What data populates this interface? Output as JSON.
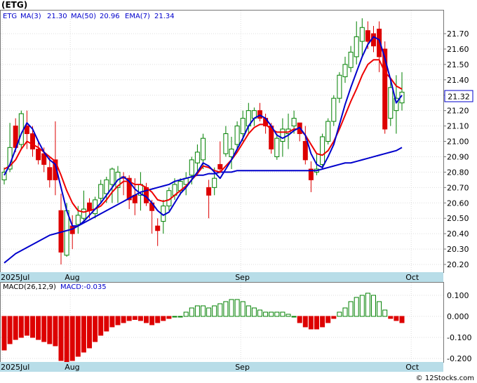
{
  "title": "(ETG)",
  "legend": {
    "ticker": "ETG",
    "ma3": "MA(3)",
    "ma3_value": "21.30",
    "ma50": "MA(50)",
    "ma50_value": "20.96",
    "ema7": "EMA(7)",
    "ema7_value": "21.34"
  },
  "macd_legend": {
    "label": "MACD(26,12,9)",
    "value": "MACD:-0.035"
  },
  "current_price_label": "21.32",
  "watermark": "© 12Stocks.com",
  "colors": {
    "up_candle_border": "#008000",
    "down_candle": "#dd0000",
    "ma_blue": "#0000cc",
    "ema_red": "#ee0000",
    "axis_band": "#b8dde8",
    "legend_text": "#0000cc"
  },
  "chart_data": [
    {
      "type": "candlestick",
      "x_labels": [
        {
          "label": "2025Jul",
          "index": 0
        },
        {
          "label": "Aug",
          "index": 12
        },
        {
          "label": "Sep",
          "index": 42
        },
        {
          "label": "Oct",
          "index": 72
        }
      ],
      "y_ticks": [
        "20.20",
        "20.30",
        "20.40",
        "20.50",
        "20.60",
        "20.70",
        "20.80",
        "20.90",
        "21.00",
        "21.10",
        "21.20",
        "21.30",
        "21.40",
        "21.50",
        "21.60",
        "21.70"
      ],
      "ylim": [
        20.14,
        21.84
      ],
      "grid": true,
      "candles": [
        [
          20.75,
          20.83,
          20.72,
          20.8
        ],
        [
          20.82,
          21.12,
          20.8,
          20.96
        ],
        [
          21.1,
          21.15,
          20.93,
          20.96
        ],
        [
          20.98,
          21.2,
          20.95,
          21.18
        ],
        [
          21.1,
          21.2,
          20.95,
          21.05
        ],
        [
          21.05,
          21.1,
          20.9,
          20.95
        ],
        [
          20.95,
          21.0,
          20.85,
          20.88
        ],
        [
          20.92,
          20.96,
          20.8,
          20.85
        ],
        [
          20.83,
          20.9,
          20.7,
          20.75
        ],
        [
          20.88,
          21.13,
          20.65,
          20.75
        ],
        [
          20.55,
          20.66,
          20.2,
          20.28
        ],
        [
          20.26,
          20.6,
          20.25,
          20.55
        ],
        [
          20.45,
          20.52,
          20.3,
          20.4
        ],
        [
          20.46,
          20.58,
          20.4,
          20.52
        ],
        [
          20.5,
          20.68,
          20.48,
          20.56
        ],
        [
          20.6,
          20.63,
          20.5,
          20.55
        ],
        [
          20.53,
          20.64,
          20.5,
          20.62
        ],
        [
          20.63,
          20.75,
          20.6,
          20.72
        ],
        [
          20.66,
          20.77,
          20.6,
          20.75
        ],
        [
          20.72,
          20.83,
          20.6,
          20.82
        ],
        [
          20.7,
          20.84,
          20.6,
          20.8
        ],
        [
          20.77,
          20.8,
          20.65,
          20.76
        ],
        [
          20.76,
          20.78,
          20.56,
          20.62
        ],
        [
          20.65,
          20.76,
          20.52,
          20.6
        ],
        [
          20.65,
          20.8,
          20.55,
          20.72
        ],
        [
          20.7,
          20.73,
          20.58,
          20.6
        ],
        [
          20.6,
          20.62,
          20.4,
          20.55
        ],
        [
          20.45,
          20.5,
          20.32,
          20.42
        ],
        [
          20.48,
          20.62,
          20.4,
          20.58
        ],
        [
          20.58,
          20.7,
          20.55,
          20.68
        ],
        [
          20.65,
          20.76,
          20.62,
          20.72
        ],
        [
          20.68,
          20.76,
          20.65,
          20.74
        ],
        [
          20.72,
          20.8,
          20.65,
          20.76
        ],
        [
          20.78,
          20.9,
          20.72,
          20.88
        ],
        [
          20.86,
          20.98,
          20.8,
          20.93
        ],
        [
          20.88,
          21.05,
          20.82,
          21.02
        ],
        [
          20.7,
          20.75,
          20.5,
          20.65
        ],
        [
          20.7,
          20.83,
          20.65,
          20.76
        ],
        [
          20.85,
          21.0,
          20.8,
          20.82
        ],
        [
          20.92,
          21.1,
          20.9,
          21.05
        ],
        [
          20.9,
          21.03,
          20.82,
          20.95
        ],
        [
          20.98,
          21.13,
          20.95,
          21.1
        ],
        [
          21.05,
          21.2,
          21.0,
          21.15
        ],
        [
          21.1,
          21.25,
          21.05,
          21.2
        ],
        [
          21.15,
          21.22,
          21.1,
          21.2
        ],
        [
          21.2,
          21.25,
          21.13,
          21.15
        ],
        [
          21.15,
          21.18,
          21.05,
          21.1
        ],
        [
          21.1,
          21.12,
          20.92,
          20.95
        ],
        [
          20.9,
          21.05,
          20.88,
          21.02
        ],
        [
          21.0,
          21.15,
          20.9,
          21.08
        ],
        [
          21.05,
          21.18,
          20.95,
          21.08
        ],
        [
          21.1,
          21.2,
          21.05,
          21.15
        ],
        [
          21.12,
          21.12,
          21.0,
          21.05
        ],
        [
          21.0,
          21.1,
          20.85,
          20.88
        ],
        [
          20.82,
          20.87,
          20.67,
          20.75
        ],
        [
          20.8,
          20.92,
          20.78,
          20.82
        ],
        [
          20.85,
          21.05,
          20.82,
          21.03
        ],
        [
          21.0,
          21.15,
          20.98,
          21.13
        ],
        [
          21.13,
          21.3,
          21.1,
          21.28
        ],
        [
          21.28,
          21.45,
          21.25,
          21.43
        ],
        [
          21.42,
          21.55,
          21.38,
          21.5
        ],
        [
          21.48,
          21.62,
          21.45,
          21.58
        ],
        [
          21.55,
          21.78,
          21.5,
          21.68
        ],
        [
          21.65,
          21.8,
          21.55,
          21.74
        ],
        [
          21.72,
          21.78,
          21.6,
          21.65
        ],
        [
          21.7,
          21.75,
          21.58,
          21.62
        ],
        [
          21.73,
          21.78,
          21.45,
          21.55
        ],
        [
          21.6,
          21.65,
          21.05,
          21.08
        ],
        [
          21.15,
          21.4,
          21.1,
          21.35
        ],
        [
          21.2,
          21.43,
          21.05,
          21.28
        ],
        [
          21.25,
          21.45,
          21.2,
          21.32
        ]
      ],
      "ma3": [
        20.78,
        20.85,
        20.95,
        21.05,
        21.12,
        21.08,
        21.0,
        20.93,
        20.88,
        20.85,
        20.7,
        20.55,
        20.45,
        20.45,
        20.48,
        20.52,
        20.56,
        20.6,
        20.65,
        20.7,
        20.75,
        20.77,
        20.74,
        20.69,
        20.66,
        20.64,
        20.6,
        20.55,
        20.52,
        20.54,
        20.6,
        20.66,
        20.7,
        20.75,
        20.8,
        20.86,
        20.84,
        20.8,
        20.76,
        20.82,
        20.88,
        20.95,
        21.02,
        21.1,
        21.15,
        21.17,
        21.15,
        21.1,
        21.04,
        21.02,
        21.04,
        21.07,
        21.09,
        21.04,
        20.92,
        20.85,
        20.83,
        20.9,
        20.98,
        21.11,
        21.24,
        21.35,
        21.45,
        21.55,
        21.63,
        21.68,
        21.66,
        21.54,
        21.4,
        21.25,
        21.3
      ],
      "ema7": [
        20.82,
        20.84,
        20.88,
        20.95,
        21.0,
        20.98,
        20.96,
        20.93,
        20.9,
        20.87,
        20.78,
        20.68,
        20.6,
        20.55,
        20.54,
        20.55,
        20.56,
        20.58,
        20.62,
        20.67,
        20.71,
        20.74,
        20.74,
        20.72,
        20.72,
        20.7,
        20.67,
        20.62,
        20.61,
        20.62,
        20.65,
        20.68,
        20.71,
        20.75,
        20.79,
        20.84,
        20.83,
        20.81,
        20.8,
        20.84,
        20.88,
        20.93,
        20.99,
        21.05,
        21.09,
        21.11,
        21.11,
        21.08,
        21.06,
        21.06,
        21.06,
        21.08,
        21.08,
        21.04,
        20.98,
        20.92,
        20.91,
        20.94,
        21.0,
        21.08,
        21.17,
        21.26,
        21.34,
        21.43,
        21.5,
        21.53,
        21.53,
        21.45,
        21.41,
        21.36,
        21.34
      ],
      "ma50": [
        20.21,
        20.24,
        20.27,
        20.29,
        20.31,
        20.33,
        20.35,
        20.37,
        20.39,
        20.4,
        20.41,
        20.42,
        20.43,
        20.45,
        20.47,
        20.49,
        20.51,
        20.53,
        20.55,
        20.57,
        20.59,
        20.61,
        20.63,
        20.65,
        20.67,
        20.68,
        20.69,
        20.7,
        20.71,
        20.72,
        20.74,
        20.75,
        20.76,
        20.77,
        20.78,
        20.78,
        20.79,
        20.79,
        20.8,
        20.8,
        20.8,
        20.81,
        20.81,
        20.81,
        20.81,
        20.81,
        20.81,
        20.81,
        20.81,
        20.81,
        20.81,
        20.81,
        20.81,
        20.81,
        20.81,
        20.81,
        20.82,
        20.83,
        20.84,
        20.85,
        20.86,
        20.86,
        20.87,
        20.88,
        20.89,
        20.9,
        20.91,
        20.92,
        20.93,
        20.94,
        20.96
      ]
    },
    {
      "type": "bar",
      "name": "MACD(26,12,9)",
      "y_ticks": [
        "0.100",
        "0.000",
        "-0.100",
        "-0.200"
      ],
      "ylim": [
        -0.22,
        0.12
      ],
      "values": [
        -0.16,
        -0.13,
        -0.11,
        -0.1,
        -0.09,
        -0.1,
        -0.11,
        -0.12,
        -0.13,
        -0.14,
        -0.21,
        -0.22,
        -0.21,
        -0.19,
        -0.17,
        -0.15,
        -0.12,
        -0.09,
        -0.07,
        -0.05,
        -0.04,
        -0.03,
        -0.02,
        -0.015,
        -0.02,
        -0.03,
        -0.04,
        -0.03,
        -0.02,
        -0.01,
        0.0,
        0.0,
        0.02,
        0.04,
        0.05,
        0.05,
        0.04,
        0.05,
        0.06,
        0.07,
        0.08,
        0.08,
        0.07,
        0.05,
        0.04,
        0.03,
        0.02,
        0.02,
        0.02,
        0.02,
        0.01,
        0.0,
        -0.03,
        -0.05,
        -0.06,
        -0.06,
        -0.05,
        -0.03,
        -0.01,
        0.02,
        0.04,
        0.07,
        0.09,
        0.1,
        0.11,
        0.1,
        0.07,
        0.03,
        -0.01,
        -0.02,
        -0.03
      ]
    }
  ]
}
